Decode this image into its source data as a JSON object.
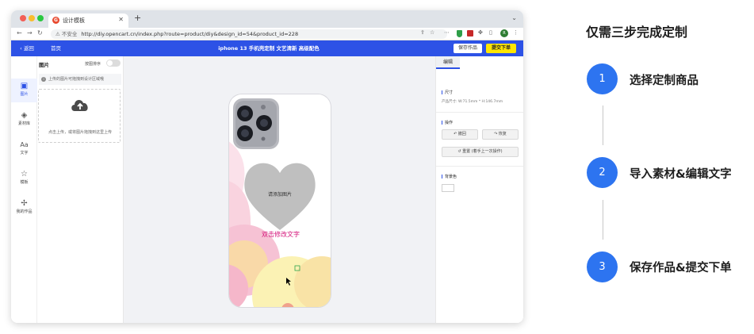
{
  "browser": {
    "tab_title": "设计模板",
    "favicon_letter": "G",
    "url_warning": "不安全",
    "url": "http://diy.opencart.cn/index.php?route=product/diy&design_id=54&product_id=228",
    "avatar_letter": "R"
  },
  "header": {
    "back_label": "返回",
    "home_label": "首页",
    "title": "iphone 13 手机壳定制 文艺清新 高级配色",
    "save_label": "保存作品",
    "submit_label": "提交下单"
  },
  "rail": {
    "items": [
      {
        "label": "图片",
        "icon": "image-icon"
      },
      {
        "label": "素材库",
        "icon": "layers-icon"
      },
      {
        "label": "文字",
        "icon": "text-icon"
      },
      {
        "label": "模板",
        "icon": "star-icon"
      },
      {
        "label": "我的作品",
        "icon": "puzzle-icon"
      }
    ]
  },
  "panel": {
    "title": "图片",
    "sort_label": "按图排序",
    "notice": "上传的图片可拖拽到设计区域哦",
    "drop_text": "点击上传，或将图片拖拽到这里上传"
  },
  "canvas": {
    "placeholder_text": "请添加图片",
    "custom_text": "双击修改文字",
    "custom_text_color": "#d4147a"
  },
  "right": {
    "tab_label": "编辑",
    "size_label": "尺寸",
    "size_value": "产品尺寸: W:71.5mm * H:146.7mm",
    "ops_label": "操作",
    "undo_label": "撤回",
    "redo_label": "恢复",
    "reset_label": "重置 (着手上一次操作)",
    "bg_label": "背景色"
  },
  "steps": {
    "title": "仅需三步完成定制",
    "items": [
      {
        "number": "1",
        "label": "选择定制商品"
      },
      {
        "number": "2",
        "label": "导入素材&编辑文字"
      },
      {
        "number": "3",
        "label": "保存作品&提交下单"
      }
    ]
  },
  "colors": {
    "brand": "#2d52e6",
    "step_blue": "#2d74f0",
    "submit_yellow": "#ffe600"
  }
}
